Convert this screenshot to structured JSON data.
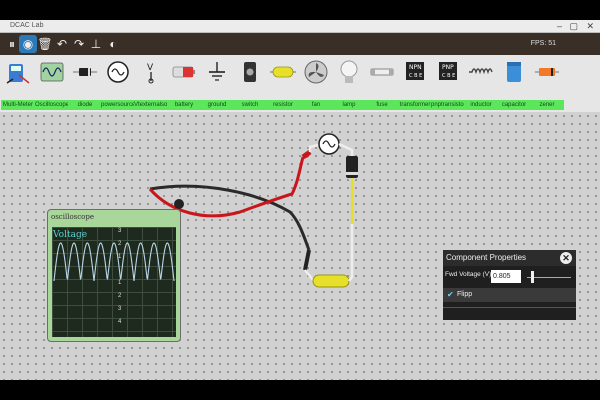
{
  "window": {
    "title": "DCAC Lab",
    "controls": [
      "–",
      "▢",
      "✕"
    ]
  },
  "toolbar": {
    "fps_label": "FPS: 51",
    "tools": [
      {
        "name": "pause",
        "icon": "pause-icon",
        "glyph": "⏸"
      },
      {
        "name": "select",
        "icon": "pointer-icon",
        "glyph": "◉"
      },
      {
        "name": "delete",
        "icon": "trash-icon",
        "glyph": "🗑"
      },
      {
        "name": "undo",
        "icon": "undo-icon",
        "glyph": "↶"
      },
      {
        "name": "redo",
        "icon": "redo-icon",
        "glyph": "↷"
      },
      {
        "name": "ground-tool",
        "icon": "ground-icon",
        "glyph": "⊥"
      },
      {
        "name": "settings",
        "icon": "gauge-icon",
        "glyph": "◐"
      }
    ]
  },
  "palette": [
    {
      "label": "Multi-Meter",
      "icon": "multimeter-icon"
    },
    {
      "label": "Oscilloscope",
      "icon": "oscilloscope-icon"
    },
    {
      "label": "diode",
      "icon": "diode-icon"
    },
    {
      "label": "powersource",
      "icon": "ac-source-icon"
    },
    {
      "label": "Vtexternalsource",
      "icon": "voltage-terminal-icon"
    },
    {
      "label": "battery",
      "icon": "battery-icon"
    },
    {
      "label": "ground",
      "icon": "ground-icon"
    },
    {
      "label": "switch",
      "icon": "switch-icon"
    },
    {
      "label": "resistor",
      "icon": "resistor-icon"
    },
    {
      "label": "fan",
      "icon": "fan-icon"
    },
    {
      "label": "lamp",
      "icon": "lamp-icon"
    },
    {
      "label": "fuse",
      "icon": "fuse-icon"
    },
    {
      "label": "transformer",
      "icon": "npn-transistor-icon"
    },
    {
      "label": "pnptransistor",
      "icon": "pnp-transistor-icon"
    },
    {
      "label": "inductor",
      "icon": "inductor-icon"
    },
    {
      "label": "capacitor",
      "icon": "capacitor-icon"
    },
    {
      "label": "zener",
      "icon": "zener-icon"
    }
  ],
  "oscilloscope": {
    "title": "oscilloscope",
    "trace_label": "Voltage",
    "ticks": [
      "3",
      "2",
      "1",
      "1",
      "2",
      "3",
      "4"
    ],
    "trace_color": "#b8d7e8"
  },
  "properties": {
    "title": "Component Properties",
    "field_label": "Fwd Voltage (V)",
    "field_value": "0.805",
    "slider_fraction": 0.08,
    "flip_label": "Flipp",
    "flip_checked": true
  },
  "colors": {
    "toolbar_bg": "#3a2f26",
    "palette_label_bg": "#5ce65c",
    "active_tool": "#2b79b7",
    "wire_red": "#c8161b",
    "wire_black": "#2a2a2a",
    "resistor": "#e6e02a"
  }
}
